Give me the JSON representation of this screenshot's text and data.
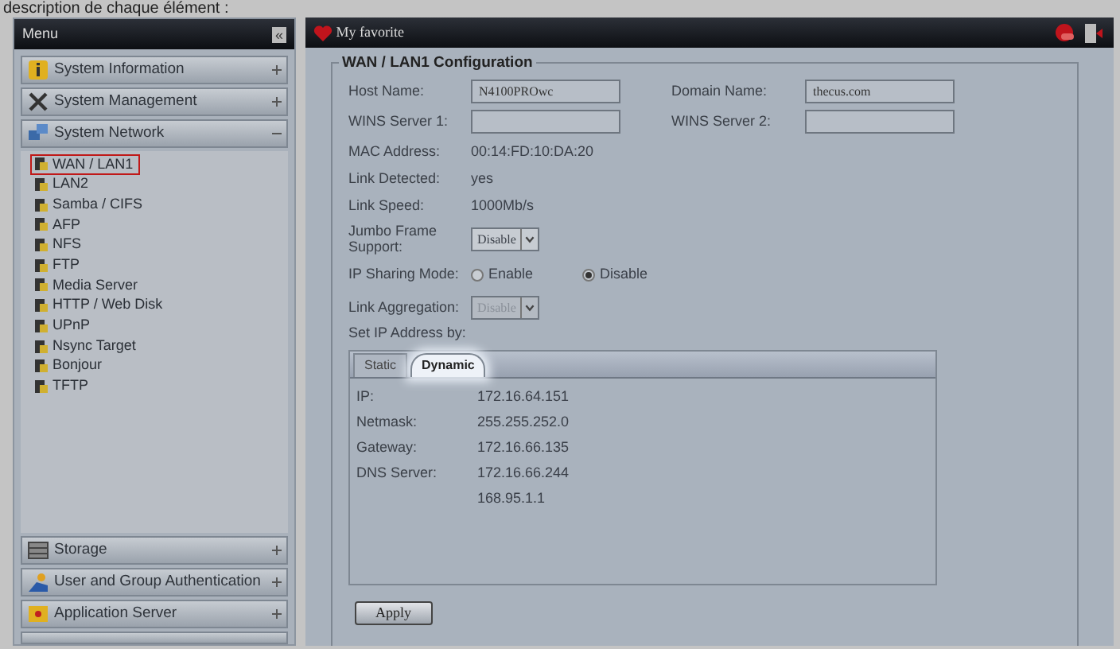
{
  "caption": "description de chaque élément :",
  "menu": {
    "title": "Menu",
    "collapse": "«",
    "sections": [
      {
        "label": "System Information",
        "expanded": false
      },
      {
        "label": "System Management",
        "expanded": false
      },
      {
        "label": "System Network",
        "expanded": true,
        "children": [
          {
            "label": "WAN / LAN1",
            "selected": true
          },
          {
            "label": "LAN2",
            "selected": false
          },
          {
            "label": "Samba / CIFS",
            "selected": false
          },
          {
            "label": "AFP",
            "selected": false
          },
          {
            "label": "NFS",
            "selected": false
          },
          {
            "label": "FTP",
            "selected": false
          },
          {
            "label": "Media Server",
            "selected": false
          },
          {
            "label": "HTTP / Web Disk",
            "selected": false
          },
          {
            "label": "UPnP",
            "selected": false
          },
          {
            "label": "Nsync Target",
            "selected": false
          },
          {
            "label": "Bonjour",
            "selected": false
          },
          {
            "label": "TFTP",
            "selected": false
          }
        ]
      },
      {
        "label": "Storage",
        "expanded": false
      },
      {
        "label": "User and Group Authentication",
        "expanded": false
      },
      {
        "label": "Application Server",
        "expanded": false
      }
    ]
  },
  "favorites_bar": {
    "title": "My favorite"
  },
  "config": {
    "legend": "WAN / LAN1 Configuration",
    "host_name": {
      "label": "Host Name:",
      "value": "N4100PROwc"
    },
    "domain_name": {
      "label": "Domain Name:",
      "value": "thecus.com"
    },
    "wins1": {
      "label": "WINS Server 1:"
    },
    "wins2": {
      "label": "WINS Server 2:"
    },
    "info": [
      {
        "label": "MAC Address:",
        "value": "00:14:FD:10:DA:20"
      },
      {
        "label": "Link Detected:",
        "value": "yes"
      },
      {
        "label": "Link Speed:",
        "value": "1000Mb/s"
      }
    ],
    "jumbo": {
      "label": "Jumbo Frame Support:",
      "value": "Disable",
      "disabled": false
    },
    "ip_sharing": {
      "label": "IP Sharing Mode:",
      "options": [
        {
          "label": "Enable",
          "selected": false
        },
        {
          "label": "Disable",
          "selected": true
        }
      ]
    },
    "link_aggregation": {
      "label": "Link Aggregation:",
      "value": "Disable",
      "disabled": true
    },
    "set_ip_label": "Set IP Address by:",
    "tabs": [
      {
        "label": "Static",
        "selected": false
      },
      {
        "label": "Dynamic",
        "selected": true
      }
    ],
    "dynamic_rows": [
      {
        "label": "IP:",
        "value": "172.16.64.151"
      },
      {
        "label": "Netmask:",
        "value": "255.255.252.0"
      },
      {
        "label": "Gateway:",
        "value": "172.16.66.135"
      },
      {
        "label": "DNS Server:",
        "value": "172.16.66.244"
      },
      {
        "value": "168.95.1.1"
      }
    ],
    "apply": "Apply"
  }
}
